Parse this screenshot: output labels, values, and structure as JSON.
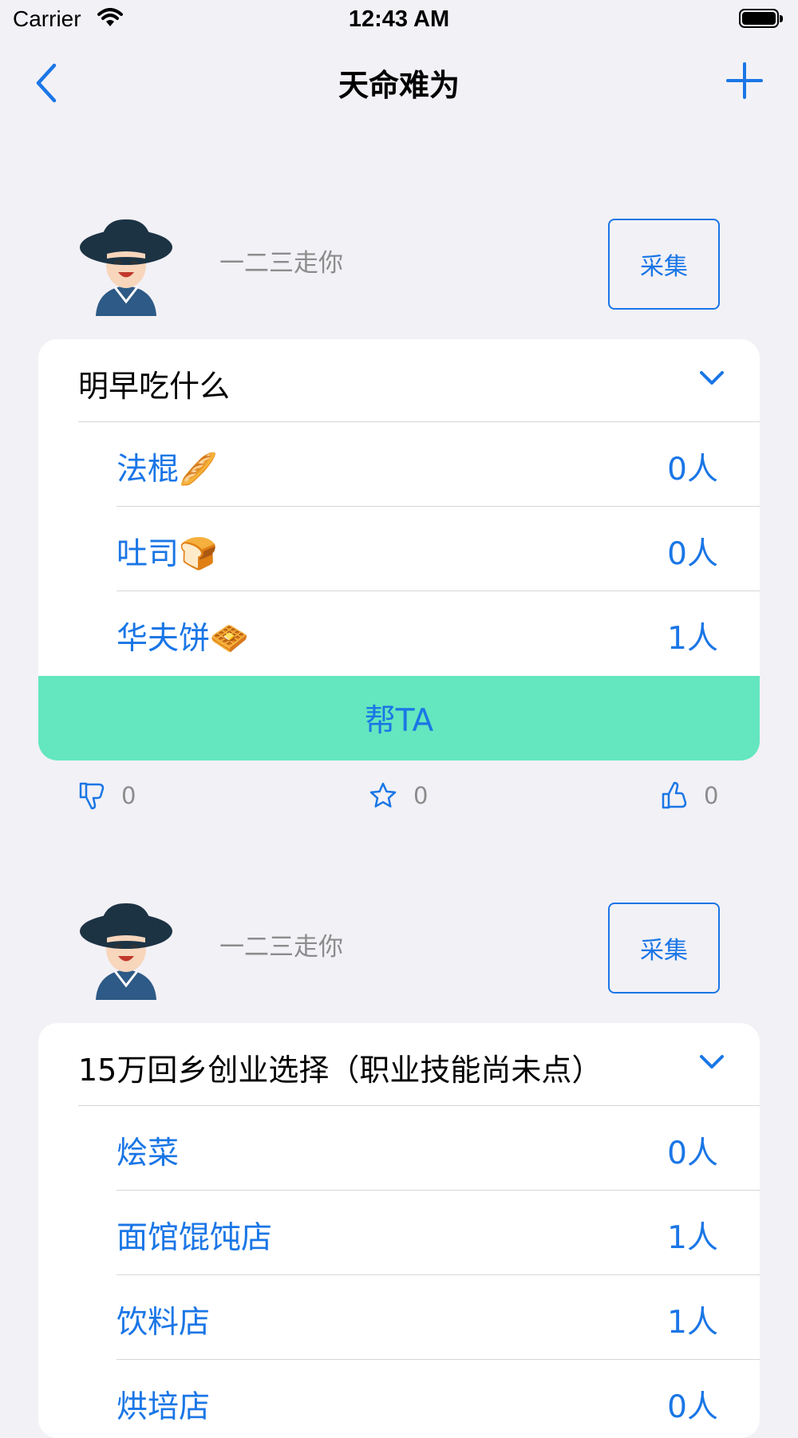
{
  "status_bar": {
    "carrier": "Carrier",
    "time": "12:43 AM"
  },
  "nav": {
    "title": "天命难为",
    "back_icon": "chevron-left-icon",
    "add_icon": "plus-icon"
  },
  "accent_color": "#1a76e6",
  "help_button_color": "#64e6bf",
  "posts": [
    {
      "username": "一二三走你",
      "collect_label": "采集",
      "question": "明早吃什么",
      "options": [
        {
          "label": "法棍🥖",
          "count": "0人"
        },
        {
          "label": "吐司🍞",
          "count": "0人"
        },
        {
          "label": "华夫饼🧇",
          "count": "1人"
        }
      ],
      "help_label": "帮TA",
      "dislikes": "0",
      "stars": "0",
      "likes": "0"
    },
    {
      "username": "一二三走你",
      "collect_label": "采集",
      "question": "15万回乡创业选择（职业技能尚未点）",
      "options": [
        {
          "label": "烩菜",
          "count": "0人"
        },
        {
          "label": "面馆馄饨店",
          "count": "1人"
        },
        {
          "label": "饮料店",
          "count": "1人"
        },
        {
          "label": "烘培店",
          "count": "0人"
        }
      ]
    }
  ]
}
